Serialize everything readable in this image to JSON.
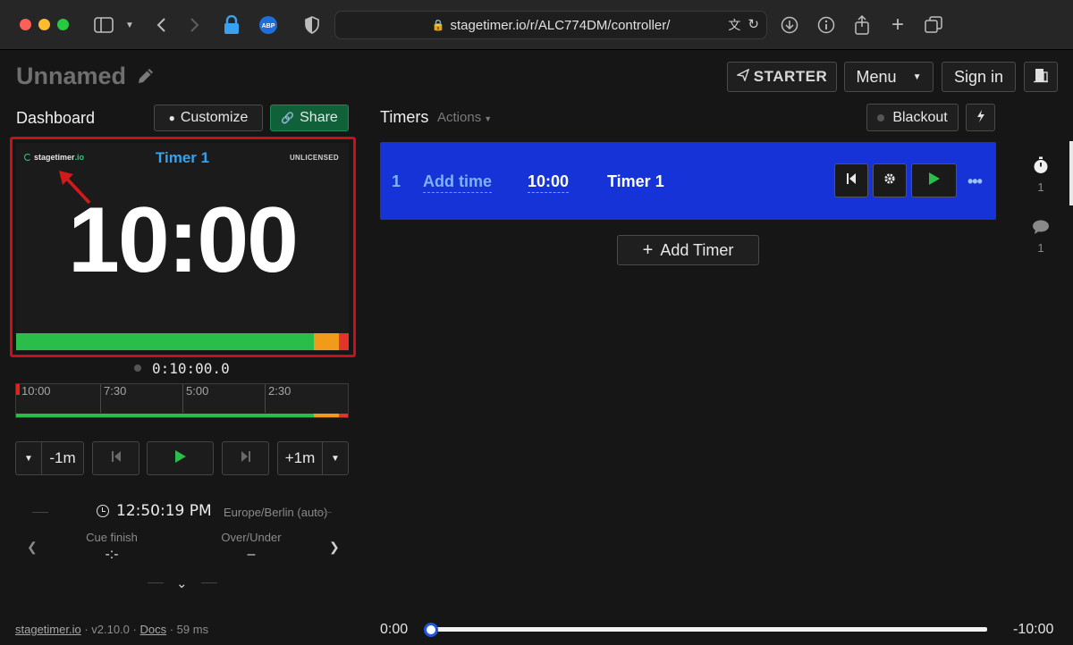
{
  "browser": {
    "url": "stagetimer.io/r/ALC774DM/controller/"
  },
  "header": {
    "project_title": "Unnamed",
    "starter_label": "STARTER",
    "menu_label": "Menu",
    "signin_label": "Sign in"
  },
  "dashboard": {
    "title": "Dashboard",
    "customize_label": "Customize",
    "share_label": "Share",
    "preview": {
      "logo_main": "stagetimer",
      "logo_tld": ".io",
      "timer_name": "Timer 1",
      "license": "UNLICENSED",
      "time": "10:00"
    },
    "elapsed": "0:10:00.0",
    "timeline_marks": [
      "10:00",
      "7:30",
      "5:00",
      "2:30"
    ],
    "controls": {
      "minus_label": "-1m",
      "plus_label": "+1m"
    },
    "clock": {
      "time": "12:50:19 PM",
      "timezone": "Europe/Berlin (auto)"
    },
    "stats": {
      "cue_finish_label": "Cue finish",
      "cue_finish_value": "-:-",
      "over_under_label": "Over/Under",
      "over_under_value": "–"
    }
  },
  "timers": {
    "title": "Timers",
    "actions_label": "Actions",
    "blackout_label": "Blackout",
    "rows": [
      {
        "index": "1",
        "add_time": "Add time",
        "duration": "10:00",
        "name": "Timer 1"
      }
    ],
    "add_timer_label": "Add Timer"
  },
  "rail": {
    "timers_count": "1",
    "messages_count": "1"
  },
  "footer": {
    "site": "stagetimer.io",
    "version": "v2.10.0",
    "docs": "Docs",
    "latency": "59 ms"
  },
  "progress": {
    "start": "0:00",
    "end": "-10:00",
    "fraction": 0
  },
  "colors": {
    "accent_blue": "#1533d6",
    "bar_green": "#2bbd4a",
    "bar_orange": "#f29a1a",
    "bar_red": "#e2342a",
    "play_green": "#2bbd4a"
  }
}
